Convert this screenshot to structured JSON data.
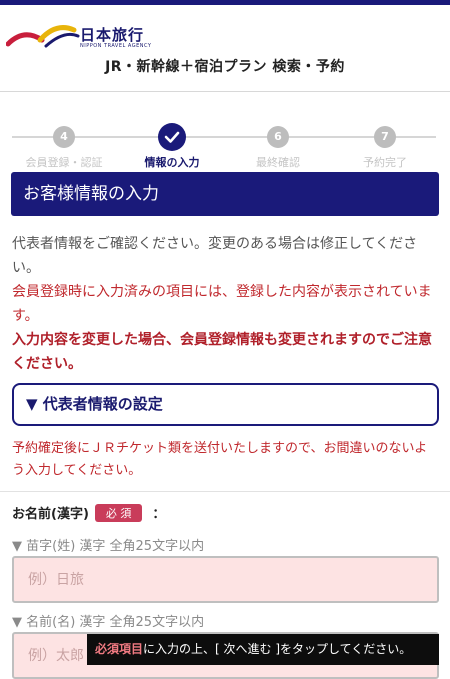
{
  "header": {
    "logo_jp": "日本旅行",
    "logo_en": "NIPPON TRAVEL AGENCY",
    "site_title": "JR・新幹線＋宿泊プラン 検索・予約"
  },
  "steps": [
    {
      "number": "4",
      "label": "会員登録・認証",
      "state": "pending"
    },
    {
      "number": "",
      "label": "情報の入力",
      "state": "current",
      "icon": "check-icon"
    },
    {
      "number": "6",
      "label": "最終確認",
      "state": "pending"
    },
    {
      "number": "7",
      "label": "予約完了",
      "state": "pending"
    }
  ],
  "section": {
    "title": "お客様情報の入力",
    "intro": "代表者情報をご確認ください。変更のある場合は修正してください。",
    "intro_red": "会員登録時に入力済みの項目には、登録した内容が表示されています。",
    "intro_bold": "入力内容を変更した場合、会員登録情報も変更されますのでご注意ください。"
  },
  "subsection": {
    "title": "▼ 代表者情報の設定",
    "note": "予約確定後にＪＲチケット類を送付いたしますので、お間違いのないよう入力してください。"
  },
  "name_field": {
    "label": "お名前(漢字)",
    "required_badge": "必 須",
    "colon": "：",
    "surname_hint": "▼ 苗字(姓) 漢字 全角25文字以内",
    "surname_placeholder": "例）日旅",
    "surname_value": "",
    "given_hint": "▼ 名前(名) 漢字 全角25文字以内",
    "given_placeholder": "例）太郎",
    "given_value": ""
  },
  "toast": {
    "highlight": "必須項目",
    "text": "に入力の上、[ 次へ進む ]をタップしてください。"
  },
  "colors": {
    "navy": "#1a1a7a",
    "red_text": "#c0282d",
    "required_badge": "#c93c5a",
    "input_bg": "#fde3e3"
  }
}
